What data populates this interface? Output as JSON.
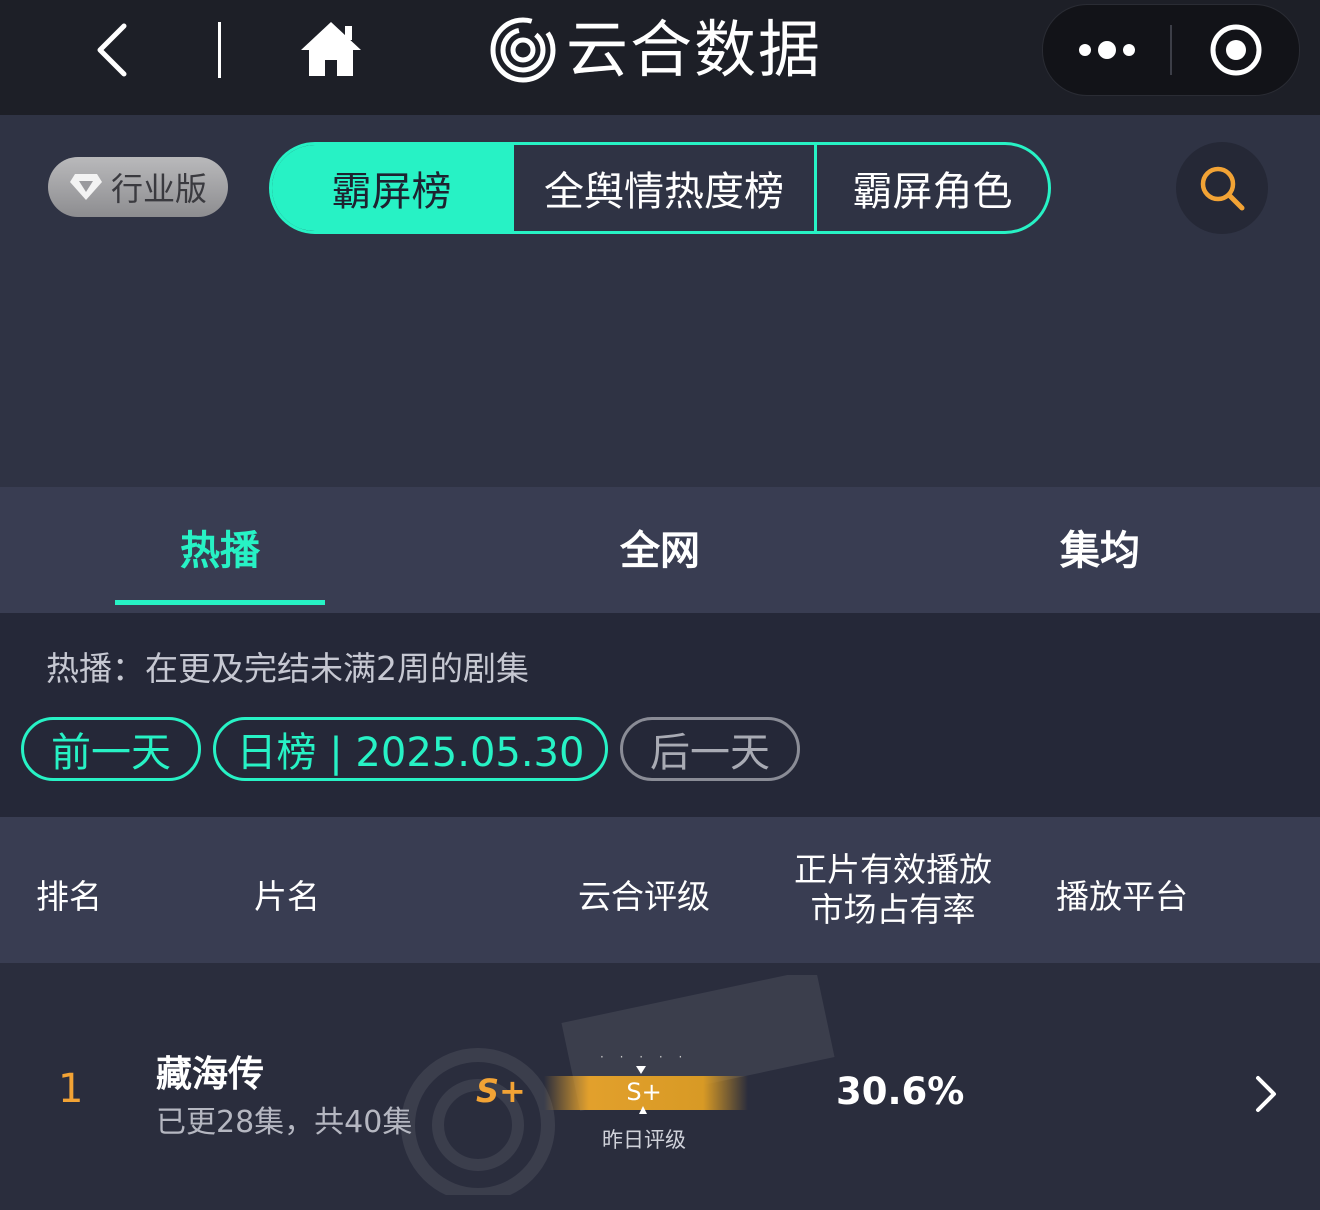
{
  "app": {
    "title": "云合数据",
    "icons": {
      "back": "chevron-left-icon",
      "home": "home-icon",
      "logo": "yunhe-logo-icon",
      "more": "more-dots-icon",
      "close": "target-circle-icon",
      "search": "search-icon"
    }
  },
  "header": {
    "edition_label": "行业版",
    "segments": [
      "霸屏榜",
      "全舆情热度榜",
      "霸屏角色"
    ],
    "active_segment": 0
  },
  "tabs": {
    "items": [
      "热播",
      "全网",
      "集均"
    ],
    "active": 0
  },
  "info": {
    "description": "热播：在更及完结未满2周的剧集"
  },
  "date_nav": {
    "prev_label": "前一天",
    "current_label": "日榜 | 2025.05.30",
    "next_label": "后一天"
  },
  "table": {
    "columns": {
      "rank": "排名",
      "title": "片名",
      "grade": "云合评级",
      "share_line1": "正片有效播放",
      "share_line2": "市场占有率",
      "platform": "播放平台"
    },
    "rows": [
      {
        "rank": "1",
        "title": "藏海传",
        "episodes": "已更28集，共40集",
        "grade": "S+",
        "yesterday_grade": "S+",
        "yesterday_caption": "昨日评级",
        "share": "30.6%"
      }
    ]
  },
  "colors": {
    "accent": "#27f2c5",
    "rank_orange": "#f2a335",
    "topbar_bg": "#1d1f27",
    "page_bg": "#2f3344"
  }
}
